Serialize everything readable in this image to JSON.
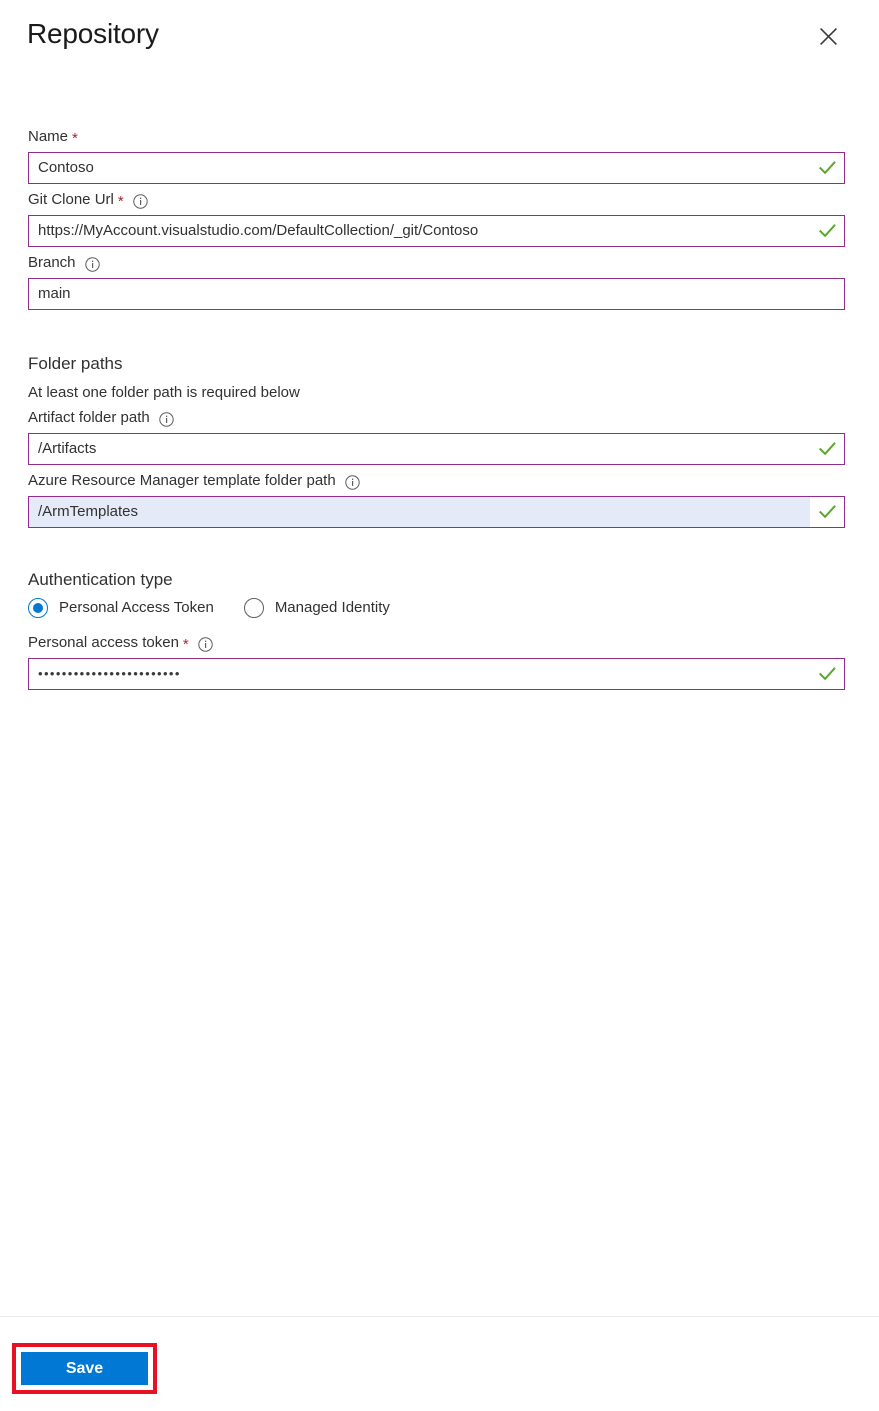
{
  "header": {
    "title": "Repository",
    "close_icon": "close-icon"
  },
  "form": {
    "name": {
      "label": "Name",
      "required": "*",
      "value": "Contoso",
      "placeholder": "",
      "validated": true
    },
    "git_clone_url": {
      "label": "Git Clone Url",
      "required": "*",
      "info_icon": "info-icon",
      "value": "https://MyAccount.visualstudio.com/DefaultCollection/_git/Contoso",
      "placeholder": "",
      "validated": true
    },
    "branch": {
      "label": "Branch",
      "info_icon": "info-icon",
      "value": "main",
      "placeholder": "",
      "validated": false
    },
    "folder_paths": {
      "heading": "Folder paths",
      "subtext": "At least one folder path is required below",
      "artifact": {
        "label": "Artifact folder path",
        "info_icon": "info-icon",
        "value": "/Artifacts",
        "placeholder": "",
        "validated": true
      },
      "arm_template": {
        "label": "Azure Resource Manager template folder path",
        "info_icon": "info-icon",
        "value": "/ArmTemplates",
        "placeholder": "",
        "validated": true,
        "highlighted": true
      }
    },
    "authentication": {
      "heading": "Authentication type",
      "options": [
        {
          "label": "Personal Access Token",
          "selected": true
        },
        {
          "label": "Managed Identity",
          "selected": false
        }
      ],
      "token": {
        "label": "Personal access token",
        "required": "*",
        "info_icon": "info-icon",
        "value": "••••••••••••••••••••••••",
        "placeholder": "",
        "validated": true
      }
    }
  },
  "footer": {
    "save_label": "Save"
  },
  "colors": {
    "accent_blue": "#0078d4",
    "field_border_purple": "#8f2e8f",
    "validation_green": "#5aa82b",
    "required_red": "#a4262c",
    "annotation_red": "#e81123",
    "highlight_bg": "#e4eaf7",
    "title_text": "#1b1a19",
    "body_text": "#323130",
    "divider": "#edebe9"
  }
}
